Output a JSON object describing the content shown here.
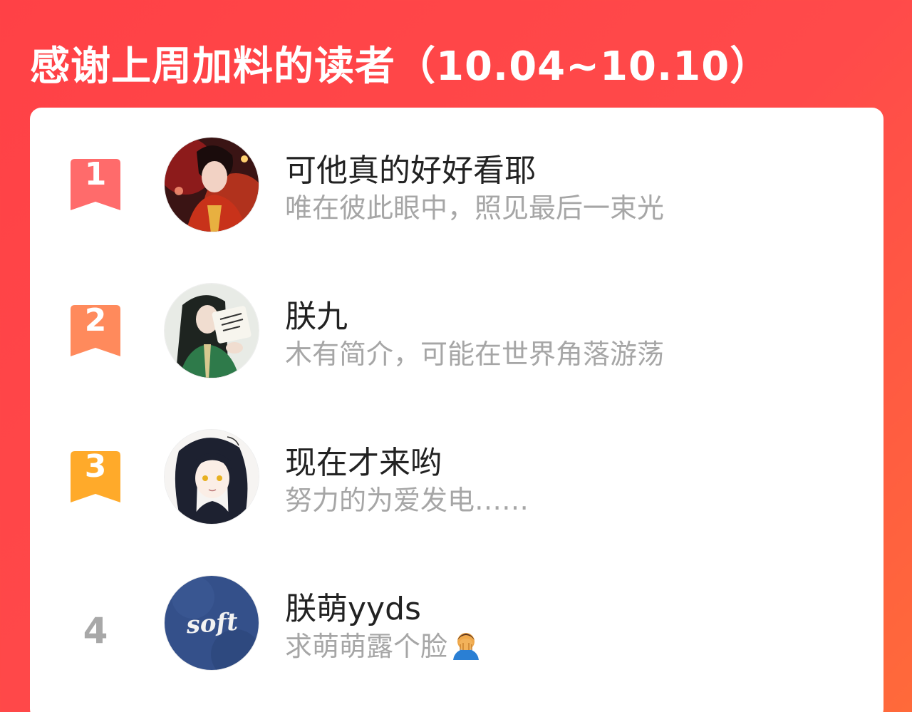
{
  "header": {
    "title": "感谢上周加料的读者（10.04~10.10）"
  },
  "readers": [
    {
      "rank": "1",
      "name": "可他真的好好看耶",
      "bio": "唯在彼此眼中，照见最后一束光",
      "badge_color": "#ff6b6b",
      "avatar_icon": "avatar-illustration-red"
    },
    {
      "rank": "2",
      "name": "朕九",
      "bio": "木有简介，可能在世界角落游荡",
      "badge_color": "#ff8a5c",
      "avatar_icon": "avatar-illustration-green"
    },
    {
      "rank": "3",
      "name": "现在才来哟",
      "bio": "努力的为爱发电……",
      "badge_color": "#ffaa2a",
      "avatar_icon": "avatar-illustration-girl"
    },
    {
      "rank": "4",
      "name": "朕萌yyds",
      "bio": "求萌萌露个脸",
      "avatar_icon": "avatar-soft-text",
      "avatar_text": "soft",
      "bio_emoji": "facepalm-emoji"
    }
  ]
}
